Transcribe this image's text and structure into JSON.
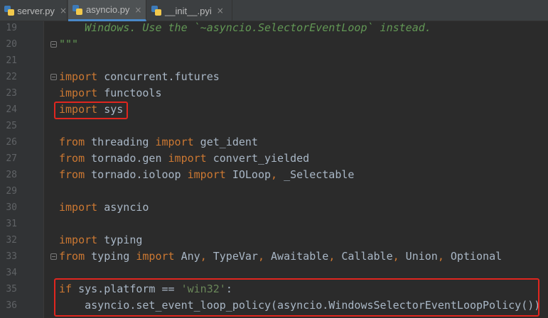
{
  "tabs": [
    {
      "label": "server.py",
      "close": "×",
      "active": false
    },
    {
      "label": "asyncio.py",
      "close": "×",
      "active": true
    },
    {
      "label": "__init__.pyi",
      "close": "×",
      "active": false
    }
  ],
  "colors": {
    "keyword": "#cc7832",
    "string": "#6a8759",
    "docstring": "#629755",
    "text": "#a9b7c6",
    "highlight": "#e0261f"
  },
  "lines": [
    {
      "num": "19",
      "tokens": [
        {
          "t": "    Windows. Use the `~asyncio.SelectorEventLoop` instead.",
          "c": "doc"
        }
      ]
    },
    {
      "num": "20",
      "tokens": [
        {
          "t": "\"\"\"",
          "c": "doc"
        }
      ]
    },
    {
      "num": "21",
      "tokens": []
    },
    {
      "num": "22",
      "tokens": [
        {
          "t": "import",
          "c": "kw"
        },
        {
          "t": " concurrent.futures",
          "c": ""
        }
      ]
    },
    {
      "num": "23",
      "tokens": [
        {
          "t": "import",
          "c": "kw"
        },
        {
          "t": " functools",
          "c": ""
        }
      ]
    },
    {
      "num": "24",
      "tokens": [
        {
          "t": "import",
          "c": "kw"
        },
        {
          "t": " sys",
          "c": ""
        }
      ]
    },
    {
      "num": "25",
      "tokens": []
    },
    {
      "num": "26",
      "tokens": [
        {
          "t": "from",
          "c": "kw"
        },
        {
          "t": " threading ",
          "c": ""
        },
        {
          "t": "import",
          "c": "kw"
        },
        {
          "t": " get_ident",
          "c": ""
        }
      ]
    },
    {
      "num": "27",
      "tokens": [
        {
          "t": "from",
          "c": "kw"
        },
        {
          "t": " tornado.gen ",
          "c": ""
        },
        {
          "t": "import",
          "c": "kw"
        },
        {
          "t": " convert_yielded",
          "c": ""
        }
      ]
    },
    {
      "num": "28",
      "tokens": [
        {
          "t": "from",
          "c": "kw"
        },
        {
          "t": " tornado.ioloop ",
          "c": ""
        },
        {
          "t": "import",
          "c": "kw"
        },
        {
          "t": " IOLoop",
          "c": ""
        },
        {
          "t": ",",
          "c": "kw"
        },
        {
          "t": " _Selectable",
          "c": ""
        }
      ]
    },
    {
      "num": "29",
      "tokens": []
    },
    {
      "num": "30",
      "tokens": [
        {
          "t": "import",
          "c": "kw"
        },
        {
          "t": " asyncio",
          "c": ""
        }
      ]
    },
    {
      "num": "31",
      "tokens": []
    },
    {
      "num": "32",
      "tokens": [
        {
          "t": "import",
          "c": "kw"
        },
        {
          "t": " typing",
          "c": ""
        }
      ]
    },
    {
      "num": "33",
      "tokens": [
        {
          "t": "from",
          "c": "kw"
        },
        {
          "t": " typing ",
          "c": ""
        },
        {
          "t": "import",
          "c": "kw"
        },
        {
          "t": " Any",
          "c": ""
        },
        {
          "t": ",",
          "c": "kw"
        },
        {
          "t": " TypeVar",
          "c": ""
        },
        {
          "t": ",",
          "c": "kw"
        },
        {
          "t": " Awaitable",
          "c": ""
        },
        {
          "t": ",",
          "c": "kw"
        },
        {
          "t": " Callable",
          "c": ""
        },
        {
          "t": ",",
          "c": "kw"
        },
        {
          "t": " Union",
          "c": ""
        },
        {
          "t": ",",
          "c": "kw"
        },
        {
          "t": " Optional",
          "c": ""
        }
      ]
    },
    {
      "num": "34",
      "tokens": []
    },
    {
      "num": "35",
      "tokens": [
        {
          "t": "if",
          "c": "kw"
        },
        {
          "t": " sys.platform == ",
          "c": ""
        },
        {
          "t": "'win32'",
          "c": "str"
        },
        {
          "t": ":",
          "c": ""
        }
      ]
    },
    {
      "num": "36",
      "tokens": [
        {
          "t": "    asyncio.set_event_loop_policy(asyncio.WindowsSelectorEventLoopPolicy())",
          "c": ""
        }
      ]
    }
  ]
}
